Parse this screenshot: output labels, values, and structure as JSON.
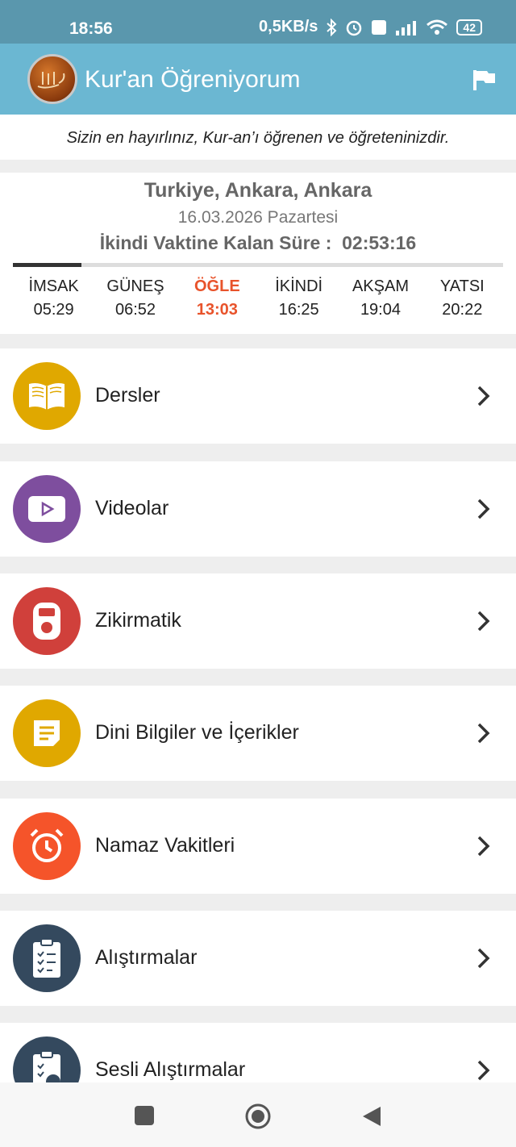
{
  "status": {
    "time": "18:56",
    "network_speed": "0,5KB/s",
    "battery": "42"
  },
  "app": {
    "title": "Kur'an Öğreniyorum"
  },
  "quote": "Sizin en hayırlınız, Kur-an’ı öğrenen ve öğreteninizdir.",
  "prayer": {
    "location": "Turkiye, Ankara, Ankara",
    "date": "16.03.2026 Pazartesi",
    "remaining_label": "İkindi Vaktine Kalan Süre :",
    "remaining_time": "02:53:16",
    "progress_fraction": 0.14,
    "times": [
      {
        "name": "İMSAK",
        "time": "05:29",
        "active": false
      },
      {
        "name": "GÜNEŞ",
        "time": "06:52",
        "active": false
      },
      {
        "name": "ÖĞLE",
        "time": "13:03",
        "active": true
      },
      {
        "name": "İKİNDİ",
        "time": "16:25",
        "active": false
      },
      {
        "name": "AKŞAM",
        "time": "19:04",
        "active": false
      },
      {
        "name": "YATSI",
        "time": "20:22",
        "active": false
      }
    ],
    "active_color": "#e8532b"
  },
  "menu": [
    {
      "label": "Dersler",
      "icon": "book-icon",
      "color": "#e0a800"
    },
    {
      "label": "Videolar",
      "icon": "video-play-icon",
      "color": "#7e4e9e"
    },
    {
      "label": "Zikirmatik",
      "icon": "counter-icon",
      "color": "#d0403b"
    },
    {
      "label": "Dini Bilgiler ve İçerikler",
      "icon": "document-icon",
      "color": "#e0a800"
    },
    {
      "label": "Namaz Vakitleri",
      "icon": "alarm-clock-icon",
      "color": "#f5542a"
    },
    {
      "label": "Alıştırmalar",
      "icon": "checklist-icon",
      "color": "#34495e"
    },
    {
      "label": "Sesli Alıştırmalar",
      "icon": "audio-checklist-icon",
      "color": "#34495e"
    }
  ]
}
